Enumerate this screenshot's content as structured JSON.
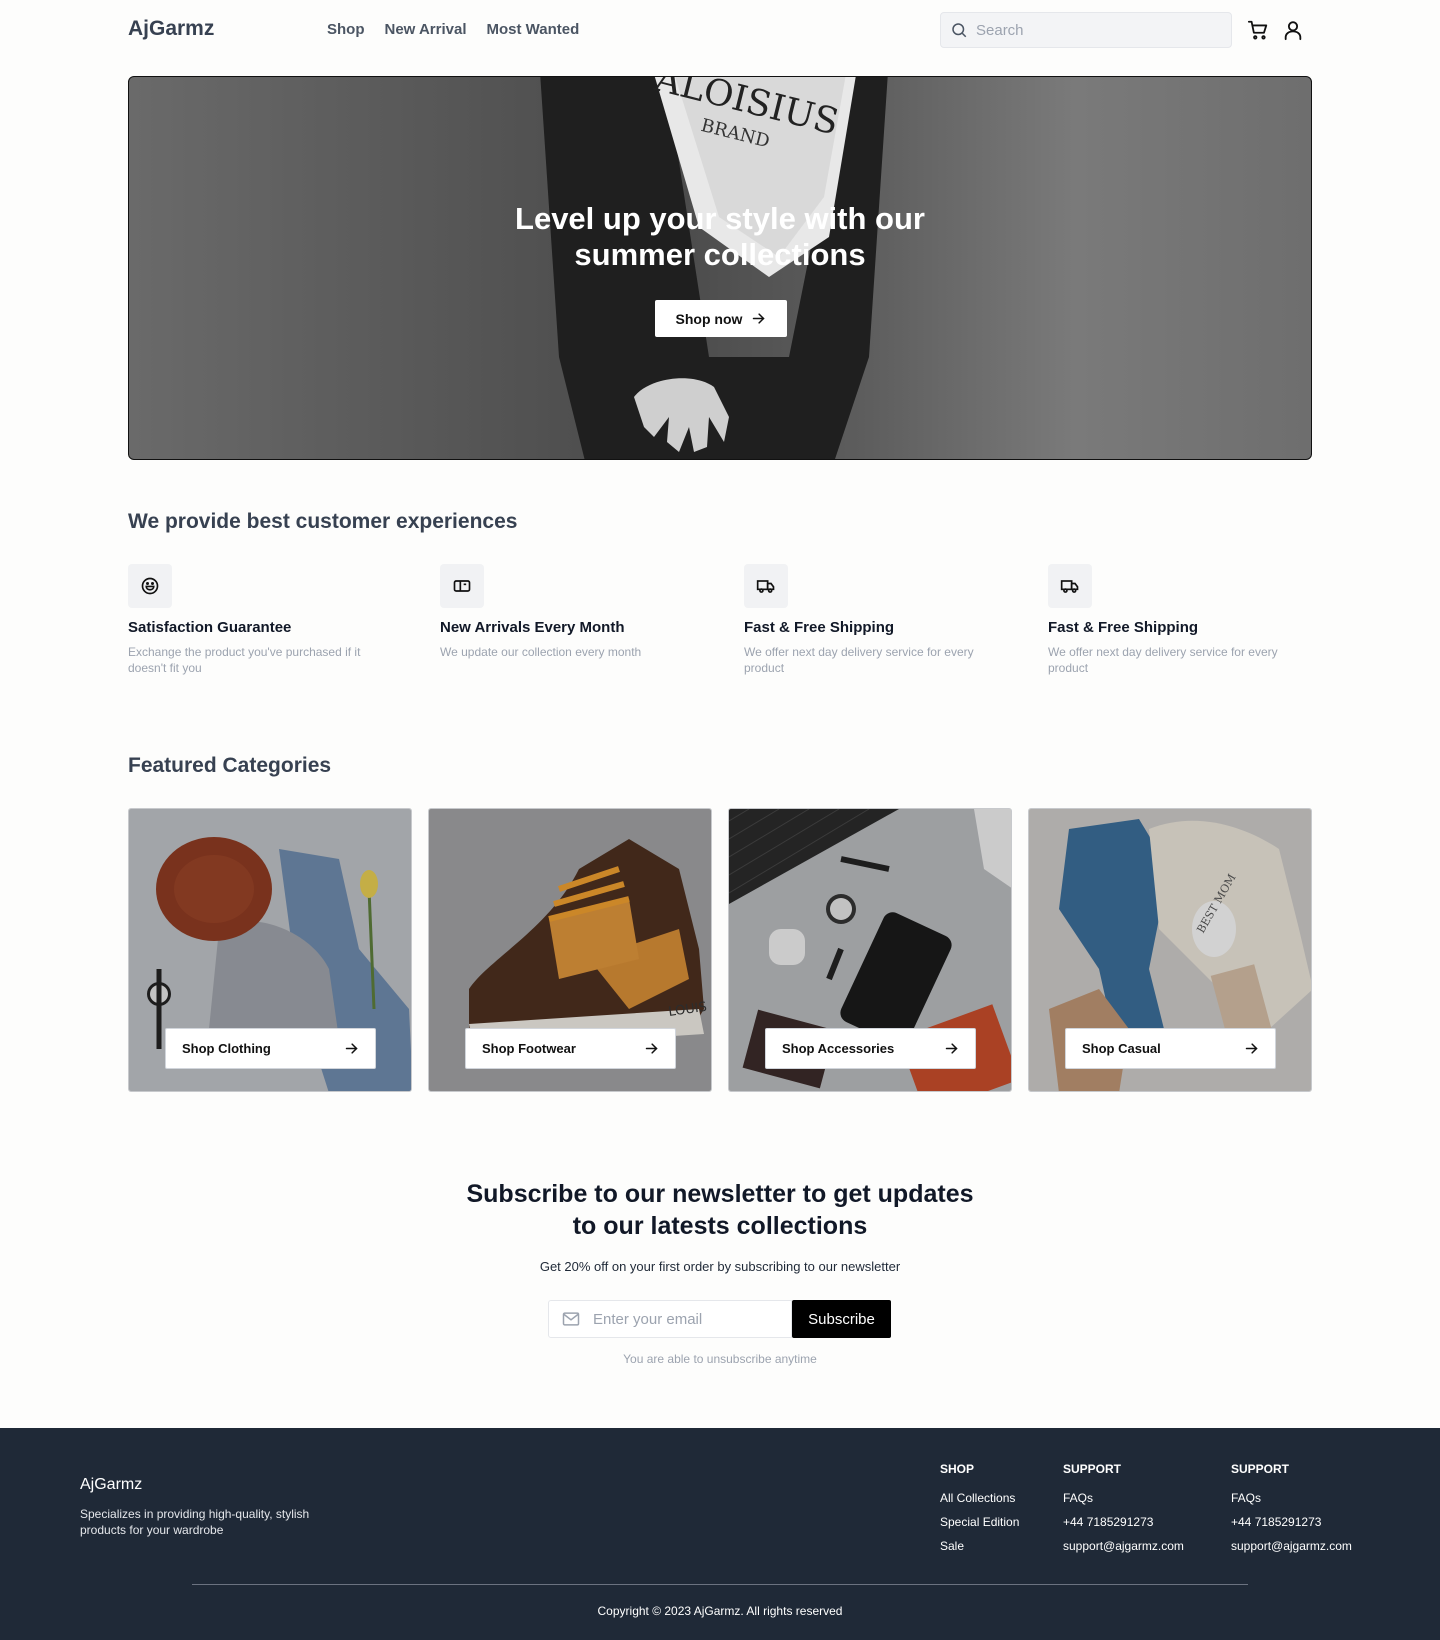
{
  "header": {
    "logo": "AjGarmz",
    "nav": [
      "Shop",
      "New Arrival",
      "Most Wanted"
    ],
    "search_placeholder": "Search",
    "icons": [
      "search-icon",
      "cart-icon",
      "user-icon"
    ]
  },
  "hero": {
    "brand_text": "ALOISIUS",
    "brand_sub": "BRAND",
    "title_line1": "Level up your style with our",
    "title_line2": "summer collections",
    "button": "Shop now"
  },
  "experiences": {
    "title": "We provide best customer experiences",
    "items": [
      {
        "icon": "smile-icon",
        "title": "Satisfaction Guarantee",
        "desc": "Exchange the product you've purchased if it doesn't fit you"
      },
      {
        "icon": "ticket-icon",
        "title": "New Arrivals Every Month",
        "desc": "We update our collection every month"
      },
      {
        "icon": "truck-icon",
        "title": "Fast & Free Shipping",
        "desc": "We offer next day delivery service for every product"
      },
      {
        "icon": "truck-icon",
        "title": "Fast & Free Shipping",
        "desc": "We offer next day delivery service for every product"
      }
    ]
  },
  "categories": {
    "title": "Featured Categories",
    "items": [
      {
        "label": "Shop Clothing"
      },
      {
        "label": "Shop Footwear",
        "shoe_text": "LOUIS"
      },
      {
        "label": "Shop Accessories"
      },
      {
        "label": "Shop Casual",
        "mug_text": "BEST MOM"
      }
    ]
  },
  "newsletter": {
    "title_line1": "Subscribe to our newsletter to get updates",
    "title_line2": "to our latests collections",
    "subtitle": "Get 20% off on your first order by subscribing to our newsletter",
    "email_placeholder": "Enter your email",
    "button": "Subscribe",
    "note": "You are able to unsubscribe anytime"
  },
  "footer": {
    "logo": "AjGarmz",
    "description": "Specializes in providing high-quality, stylish products for your wardrobe",
    "columns": [
      {
        "title": "SHOP",
        "links": [
          "All Collections",
          "Special Edition",
          "Sale"
        ]
      },
      {
        "title": "SUPPORT",
        "links": [
          "FAQs",
          "+44 7185291273",
          "support@ajgarmz.com"
        ]
      },
      {
        "title": "SUPPORT",
        "links": [
          "FAQs",
          "+44 7185291273",
          "support@ajgarmz.com"
        ]
      }
    ],
    "copyright": "Copyright © 2023 AjGarmz. All rights reserved"
  },
  "colors": {
    "footer_bg": "#1f2937",
    "button_dark": "#000000",
    "text_heading": "#374151",
    "text_muted": "#9ca3af"
  }
}
